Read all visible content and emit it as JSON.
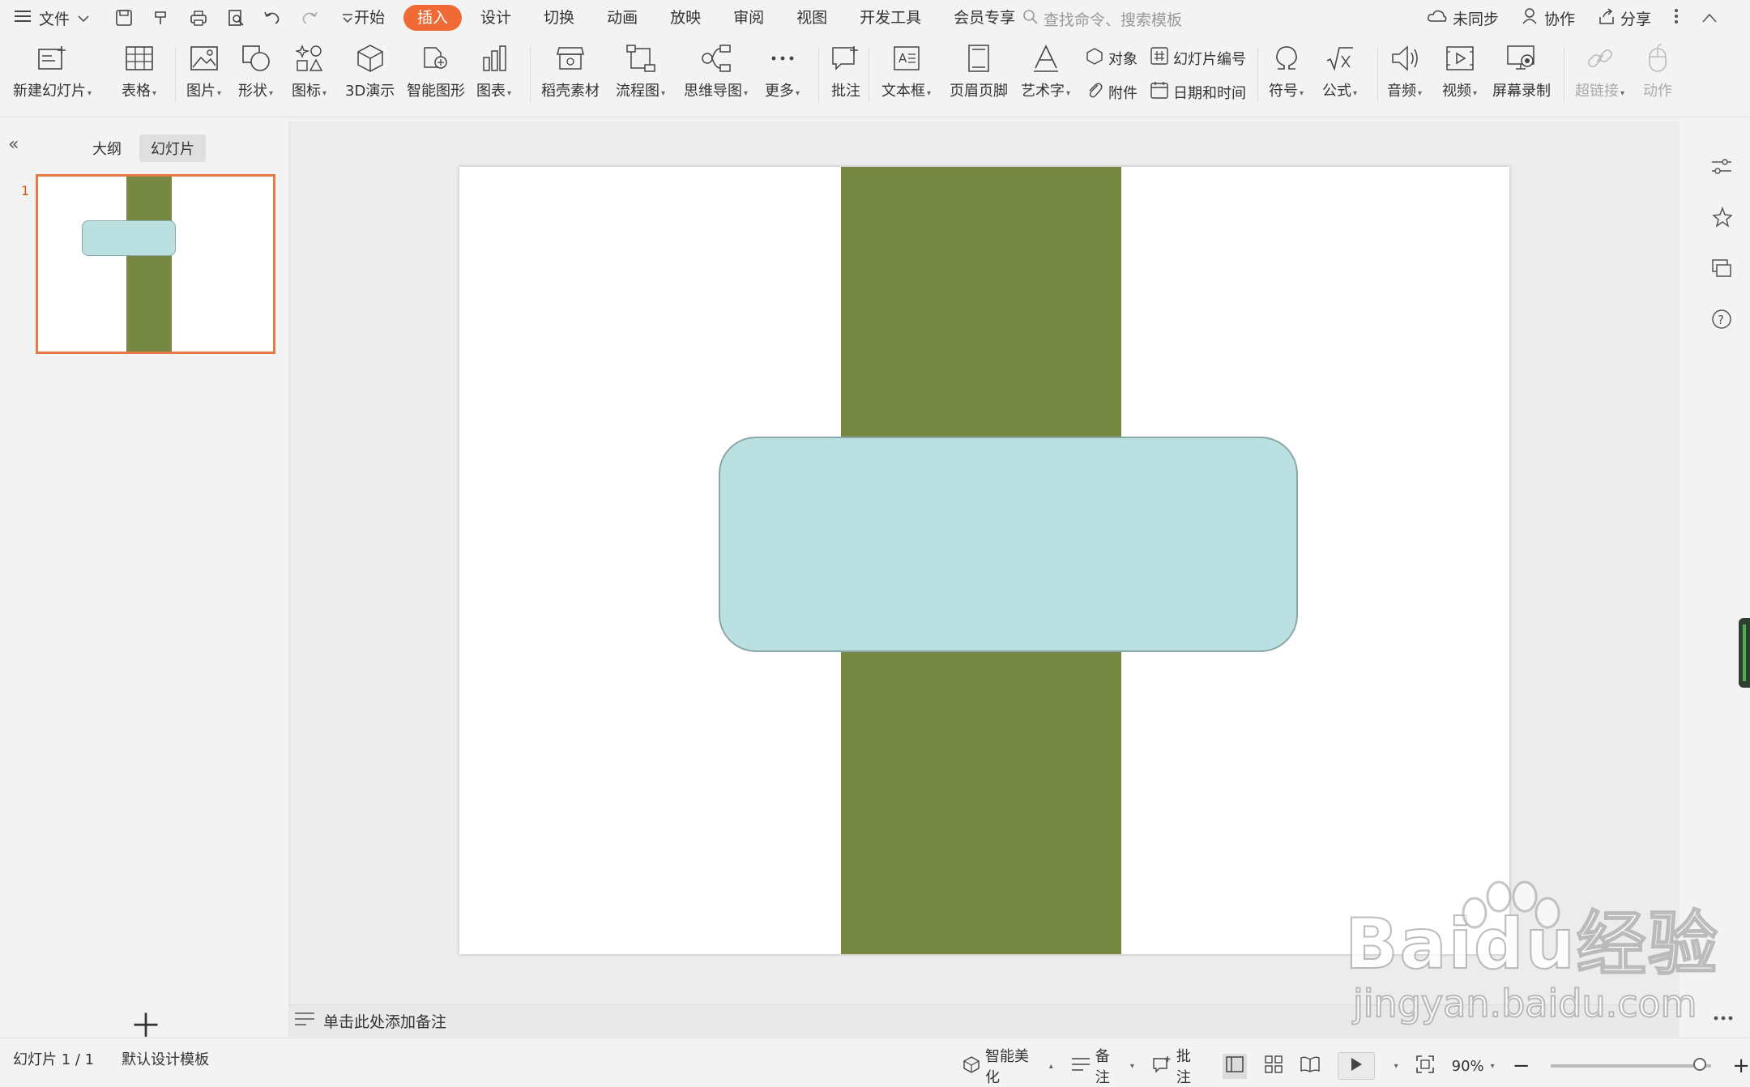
{
  "topbar": {
    "file_label": "文件",
    "tabs": [
      {
        "label": "开始"
      },
      {
        "label": "插入",
        "active": true
      },
      {
        "label": "设计"
      },
      {
        "label": "切换"
      },
      {
        "label": "动画"
      },
      {
        "label": "放映"
      },
      {
        "label": "审阅"
      },
      {
        "label": "视图"
      },
      {
        "label": "开发工具"
      },
      {
        "label": "会员专享"
      }
    ],
    "search_placeholder": "查找命令、搜索模板",
    "sync_label": "未同步",
    "collab_label": "协作",
    "share_label": "分享",
    "accent_color": "#f06a35"
  },
  "ribbon": {
    "new_slide": "新建幻灯片",
    "table": "表格",
    "picture": "图片",
    "shape": "形状",
    "icon": "图标",
    "demo3d": "3D演示",
    "smartart": "智能图形",
    "chart": "图表",
    "material": "稻壳素材",
    "flowchart": "流程图",
    "mindmap": "思维导图",
    "more": "更多",
    "comment": "批注",
    "textbox": "文本框",
    "header_footer": "页眉页脚",
    "wordart": "艺术字",
    "object": "对象",
    "slide_number": "幻灯片编号",
    "attachment": "附件",
    "datetime": "日期和时间",
    "symbol": "符号",
    "formula": "公式",
    "audio": "音频",
    "video": "视频",
    "screen_record": "屏幕录制",
    "hyperlink": "超链接",
    "action": "动作"
  },
  "panel": {
    "outline_tab": "大纲",
    "slides_tab": "幻灯片",
    "thumb_number": "1"
  },
  "slide": {
    "bar_color": "#778845",
    "box_fill": "#bae0e2",
    "box_border": "#8aa7a9"
  },
  "notes": {
    "placeholder": "单击此处添加备注"
  },
  "status": {
    "slide_count": "幻灯片 1 / 1",
    "template": "默认设计模板",
    "beautify": "智能美化",
    "notes": "备注",
    "comment": "批注",
    "zoom": "90%"
  },
  "watermark": {
    "main": "Baidu经验",
    "sub": "jingyan.baidu.com"
  }
}
